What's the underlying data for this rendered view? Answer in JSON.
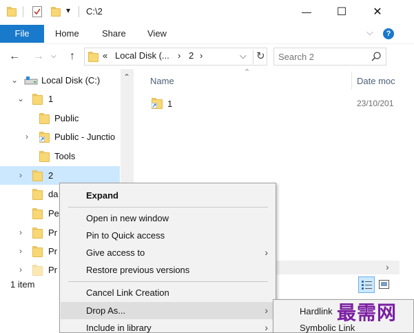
{
  "window": {
    "title": "C:\\2",
    "minimize_glyph": "—",
    "maximize_glyph": "☐",
    "close_glyph": "✕",
    "quick_access_dropdown_glyph": "▾"
  },
  "ribbon": {
    "tabs": [
      "File",
      "Home",
      "Share",
      "View"
    ],
    "expand_glyph": "⌵",
    "help_glyph": "?"
  },
  "address_bar": {
    "back_glyph": "←",
    "forward_glyph": "→",
    "up_glyph": "↑",
    "overflow": "«",
    "crumbs": [
      "Local Disk (...",
      "2"
    ],
    "crumb_sep": "›",
    "dropdown_glyph": "⌵",
    "refresh_glyph": "↻"
  },
  "search": {
    "placeholder": "Search 2",
    "icon": "search-icon"
  },
  "nav_pane": {
    "items": [
      {
        "label": "Local Disk (C:)",
        "chevron": "⌄",
        "icon": "drive-icon"
      },
      {
        "label": "1",
        "chevron": "⌄",
        "icon": "folder-icon"
      },
      {
        "label": "Public",
        "chevron": "",
        "icon": "folder-icon"
      },
      {
        "label": "Public - Junctio",
        "chevron": "›",
        "icon": "junction-folder-icon"
      },
      {
        "label": "Tools",
        "chevron": "",
        "icon": "folder-icon"
      },
      {
        "label": "2",
        "chevron": "›",
        "icon": "folder-icon",
        "selected": true
      },
      {
        "label": "da",
        "chevron": "",
        "icon": "folder-icon"
      },
      {
        "label": "Pe",
        "chevron": "",
        "icon": "folder-icon"
      },
      {
        "label": "Pr",
        "chevron": "›",
        "icon": "folder-icon"
      },
      {
        "label": "Pr",
        "chevron": "›",
        "icon": "folder-icon"
      },
      {
        "label": "Pr",
        "chevron": "›",
        "icon": "folder-icon"
      }
    ],
    "scroll_up_glyph": "⌃"
  },
  "content": {
    "sort_glyph": "⌃",
    "columns": [
      "Name",
      "Date moc"
    ],
    "files": [
      {
        "name": "1",
        "date": "23/10/201",
        "icon": "junction-folder-icon"
      }
    ],
    "hscroll_right_glyph": "›"
  },
  "status_bar": {
    "item_count": "1 item"
  },
  "context_menu": {
    "items": [
      {
        "label": "Expand",
        "bold": true
      },
      {
        "label": "Open in new window"
      },
      {
        "label": "Pin to Quick access"
      },
      {
        "label": "Give access to",
        "submenu": true
      },
      {
        "label": "Restore previous versions"
      },
      {
        "label": "Cancel Link Creation"
      },
      {
        "label": "Drop As...",
        "submenu": true,
        "highlighted": true
      },
      {
        "label": "Include in library",
        "submenu": true
      }
    ],
    "submenu_arrow": "›"
  },
  "submenu": {
    "items": [
      "Hardlink",
      "Symbolic Link"
    ]
  },
  "watermark": {
    "text": "最需网"
  },
  "colors": {
    "accent": "#1979ca",
    "selection": "#cce8ff",
    "folder": "#f8d775",
    "menu_bg": "#f2f2f2",
    "watermark": "#7b1fa2"
  }
}
